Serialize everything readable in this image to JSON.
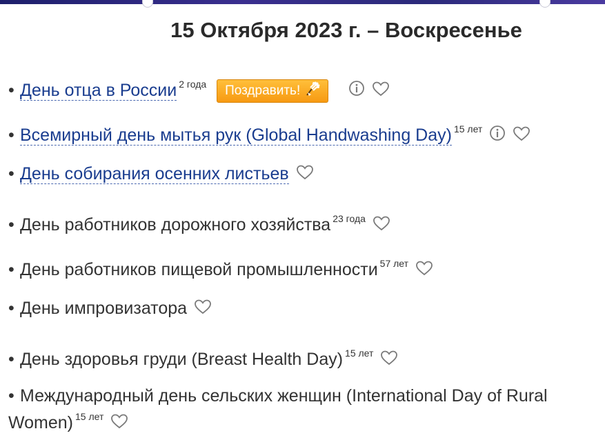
{
  "page": {
    "title": "15 Октября 2023 г. – Воскресенье"
  },
  "colors": {
    "link": "#1a3d8f",
    "text": "#333333",
    "button_orange": "#f79a12",
    "top_strip": "#2b2a7a"
  },
  "holidays": [
    {
      "name": "День отца в России",
      "age": "2 года",
      "is_link": true,
      "congrats_label": "Поздравить!",
      "has_info": true,
      "icons": [
        "info-icon",
        "heart-icon",
        "bouquet-icon"
      ]
    },
    {
      "name": "Всемирный день мытья рук (Global Handwashing Day)",
      "age": "15 лет",
      "is_link": true,
      "has_info": true,
      "icons": [
        "info-icon",
        "heart-icon"
      ]
    },
    {
      "name": "День собирания осенних листьев",
      "is_link": true,
      "icons": [
        "heart-icon"
      ]
    },
    {
      "name": "День работников дорожного хозяйства",
      "age": "23 года",
      "is_link": false,
      "icons": [
        "heart-icon"
      ]
    },
    {
      "name": "День работников пищевой промышленности",
      "age": "57 лет",
      "is_link": false,
      "icons": [
        "heart-icon"
      ]
    },
    {
      "name": "День импровизатора",
      "is_link": false,
      "icons": [
        "heart-icon"
      ]
    },
    {
      "name": "День здоровья груди (Breast Health Day)",
      "age": "15 лет",
      "is_link": false,
      "icons": [
        "heart-icon"
      ]
    },
    {
      "name": "Международный день сельских женщин (International Day of Rural Women)",
      "age": "15 лет",
      "is_link": false,
      "icons": [
        "heart-icon"
      ]
    }
  ]
}
